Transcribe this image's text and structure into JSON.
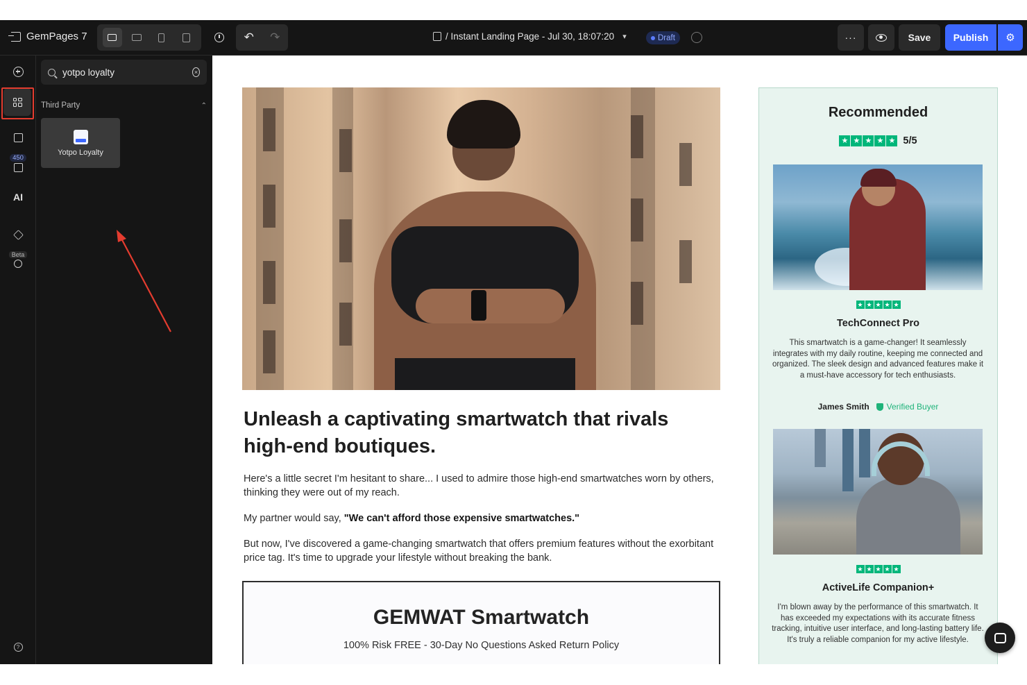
{
  "app": {
    "logo_text": "GemPages 7",
    "page_title": "/ Instant Landing Page - Jul 30, 18:07:20",
    "status_badge": "Draft",
    "more_label": "···",
    "save_label": "Save",
    "publish_label": "Publish"
  },
  "rail": {
    "count_badge": "450",
    "ai_label": "AI",
    "beta_label": "Beta"
  },
  "panel": {
    "search_value": "yotpo loyalty",
    "section_title": "Third Party",
    "items": [
      {
        "label": "Yotpo Loyalty"
      }
    ]
  },
  "canvas": {
    "headline": "Unleash a captivating smartwatch that rivals high-end boutiques.",
    "para1": "Here's a little secret I'm hesitant to share... I used to admire those high-end smartwatches worn by others, thinking they were out of my reach.",
    "para2_prefix": "My partner would say, ",
    "para2_bold": "\"We can't afford those expensive smartwatches.\"",
    "para3": "But now, I've discovered a game-changing smartwatch that offers premium features without the exorbitant price tag. It's time to upgrade your lifestyle without breaking the bank.",
    "product_title": "GEMWAT Smartwatch",
    "product_subtitle": "100% Risk FREE - 30-Day No Questions Asked Return Policy"
  },
  "recommended": {
    "title": "Recommended",
    "rating": "5/5",
    "reviews": [
      {
        "name": "TechConnect Pro",
        "text": "This smartwatch is a game-changer! It seamlessly integrates with my daily routine, keeping me connected and organized. The sleek design and advanced features make it a must-have accessory for tech enthusiasts.",
        "author": "James Smith",
        "verified": "Verified Buyer"
      },
      {
        "name": "ActiveLife Companion+",
        "text": "I'm blown away by the performance of this smartwatch. It has exceeded my expectations with its accurate fitness tracking, intuitive user interface, and long-lasting battery life. It's truly a reliable companion for my active lifestyle."
      }
    ]
  },
  "colors": {
    "accent": "#3c67ff",
    "highlight": "#e43c2f",
    "star_green": "#00b67a"
  }
}
